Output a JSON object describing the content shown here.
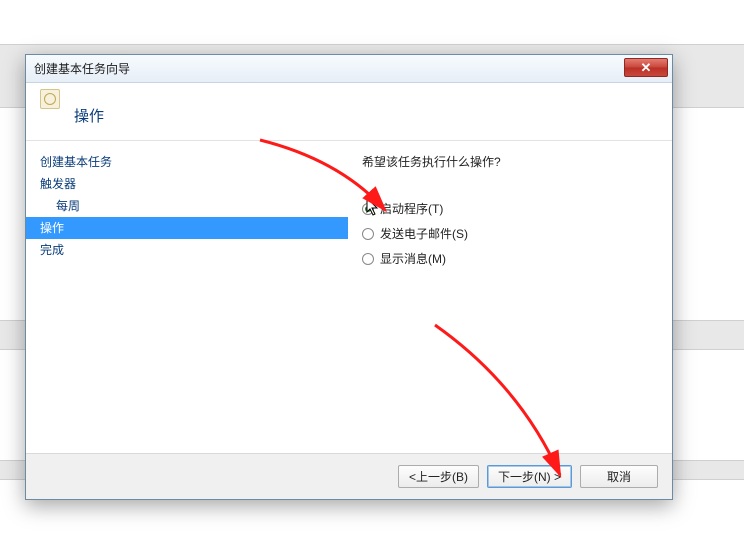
{
  "window": {
    "title": "创建基本任务向导",
    "close_glyph": "✕"
  },
  "header": {
    "heading": "操作"
  },
  "sidebar": {
    "steps": [
      "创建基本任务",
      "触发器",
      "每周",
      "操作",
      "完成"
    ]
  },
  "main": {
    "prompt": "希望该任务执行什么操作?",
    "options": {
      "start_program": "启动程序(T)",
      "send_email": "发送电子邮件(S)",
      "display_message": "显示消息(M)"
    }
  },
  "buttons": {
    "back": "<上一步(B)",
    "next": "下一步(N) >",
    "cancel": "取消"
  }
}
